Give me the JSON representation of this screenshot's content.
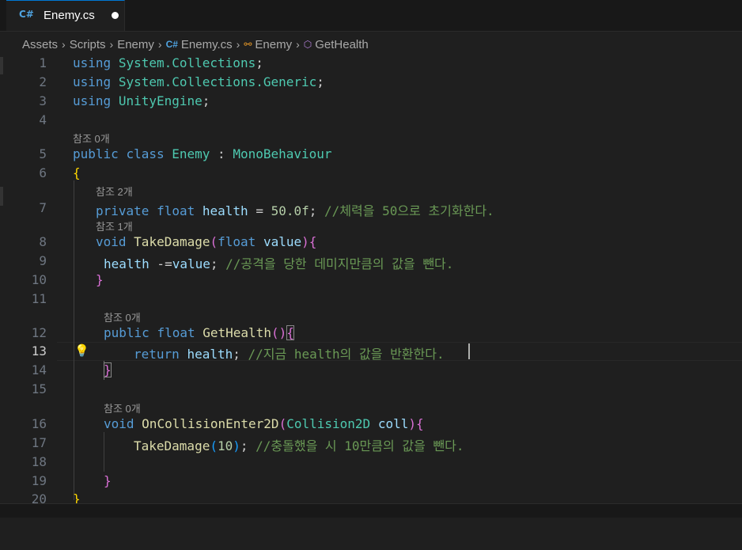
{
  "tab": {
    "icon": "C#",
    "label": "Enemy.cs"
  },
  "breadcrumb": [
    "Assets",
    "Scripts",
    "Enemy",
    "Enemy.cs",
    "Enemy",
    "GetHealth"
  ],
  "lenses": [
    "참조 0개",
    "참조 2개",
    "참조 1개",
    "참조 0개",
    "참조 0개"
  ],
  "lines": {
    "n1": "1",
    "n2": "2",
    "n3": "3",
    "n4": "4",
    "n5": "5",
    "n6": "6",
    "n7": "7",
    "n8": "8",
    "n9": "9",
    "n10": "10",
    "n11": "11",
    "n12": "12",
    "n13": "13",
    "n14": "14",
    "n15": "15",
    "n16": "16",
    "n17": "17",
    "n18": "18",
    "n19": "19",
    "n20": "20"
  },
  "tok": {
    "using": "using",
    "sys_collections": "System.Collections",
    "sys_collections_generic": "System.Collections.Generic",
    "unity_engine": "UnityEngine",
    "semicolon": ";",
    "public": "public",
    "class": "class",
    "enemy": "Enemy",
    "colon": " : ",
    "mono": "MonoBehaviour",
    "open_brace": "{",
    "close_brace": "}",
    "private": "private",
    "float": "float",
    "void": "void",
    "return": "return",
    "health": "health",
    "assign": " = ",
    "fifty": "50.0f",
    "cm7": "//체력을 50으로 초기화한다.",
    "take_damage": "TakeDamage",
    "open_paren": "(",
    "close_paren": ")",
    "value": "value",
    "minus_eq": " -=",
    "cm9": "//공격을 당한 데미지만큼의 값을 뺀다.",
    "get_health": "GetHealth",
    "cm13": "//지금 health의 값을 반환한다.",
    "on_collision": "OnCollisionEnter2D",
    "collision2d": "Collision2D",
    "coll": "coll",
    "ten": "10",
    "cm17": "//충돌했을 시 10만큼의 값을 뺀다."
  }
}
